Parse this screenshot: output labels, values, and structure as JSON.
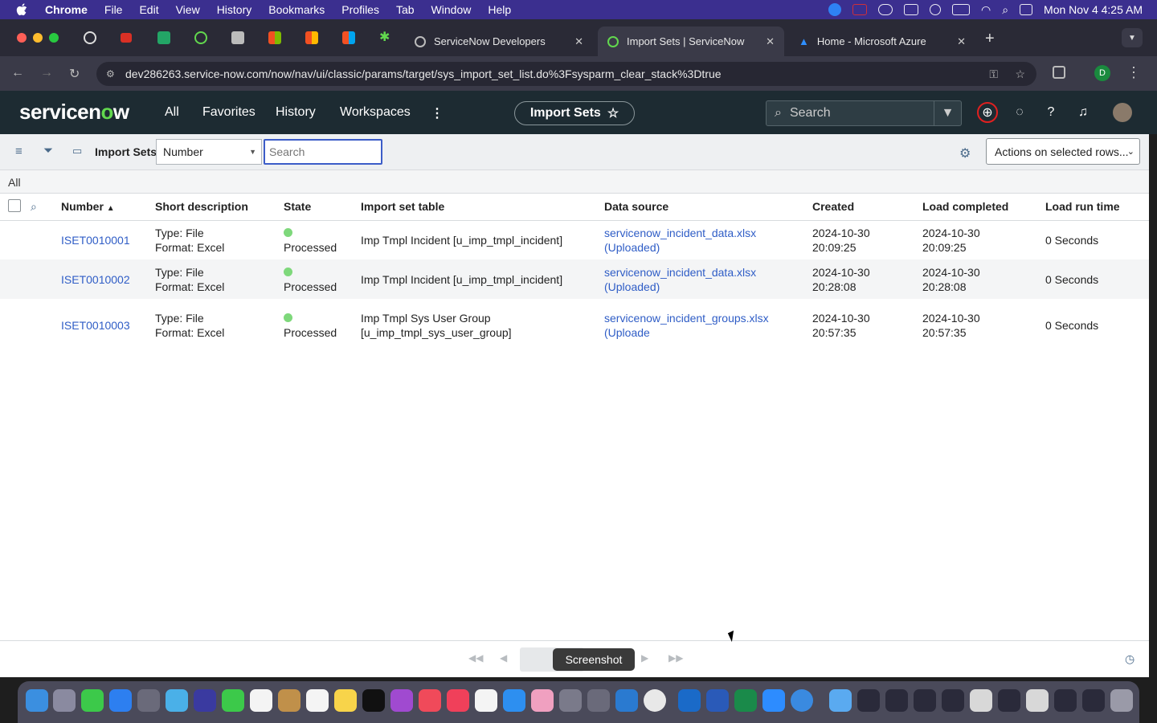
{
  "menubar": {
    "app": "Chrome",
    "items": [
      "File",
      "Edit",
      "View",
      "History",
      "Bookmarks",
      "Profiles",
      "Tab",
      "Window",
      "Help"
    ],
    "clock": "Mon Nov 4  4:25 AM"
  },
  "tabs": [
    {
      "label": "ServiceNow Developers"
    },
    {
      "label": "Import Sets | ServiceNow"
    },
    {
      "label": "Home - Microsoft Azure"
    }
  ],
  "address": {
    "url": "dev286263.service-now.com/now/nav/ui/classic/params/target/sys_import_set_list.do%3Fsysparm_clear_stack%3Dtrue"
  },
  "header": {
    "logo": "servicenow",
    "nav": [
      "All",
      "Favorites",
      "History",
      "Workspaces"
    ],
    "page_pill": "Import Sets",
    "search_placeholder": "Search"
  },
  "list": {
    "title": "Import Sets",
    "field": "Number",
    "search_placeholder": "Search",
    "actions": "Actions on selected rows...",
    "breadcrumb": "All",
    "columns": [
      "Number",
      "Short description",
      "State",
      "Import set table",
      "Data source",
      "Created",
      "Load completed",
      "Load run time"
    ],
    "rows": [
      {
        "number": "ISET0010001",
        "desc1": "Type: File",
        "desc2": "Format: Excel",
        "state": "Processed",
        "table1": "Imp Tmpl Incident [u_imp_tmpl_incident]",
        "table2": "",
        "ds1": "servicenow_incident_data.xlsx",
        "ds2": "(Uploaded)",
        "created1": "2024-10-30",
        "created2": "20:09:25",
        "loaded1": "2024-10-30",
        "loaded2": "20:09:25",
        "runtime": "0 Seconds"
      },
      {
        "number": "ISET0010002",
        "desc1": "Type: File",
        "desc2": "Format: Excel",
        "state": "Processed",
        "table1": "Imp Tmpl Incident [u_imp_tmpl_incident]",
        "table2": "",
        "ds1": "servicenow_incident_data.xlsx",
        "ds2": "(Uploaded)",
        "created1": "2024-10-30",
        "created2": "20:28:08",
        "loaded1": "2024-10-30",
        "loaded2": "20:28:08",
        "runtime": "0 Seconds"
      },
      {
        "number": "ISET0010003",
        "desc1": "Type: File",
        "desc2": "Format: Excel",
        "state": "Processed",
        "table1": "Imp Tmpl Sys User Group",
        "table2": "[u_imp_tmpl_sys_user_group]",
        "ds1": "servicenow_incident_groups.xlsx",
        "ds2": "(Uploade",
        "created1": "2024-10-30",
        "created2": "20:57:35",
        "loaded1": "2024-10-30",
        "loaded2": "20:57:35",
        "runtime": "0 Seconds"
      }
    ]
  },
  "tooltip": "Screenshot",
  "colors": {
    "accent": "#2f5dc6",
    "processed": "#7ed87b",
    "header_bg": "#1d2b32"
  }
}
